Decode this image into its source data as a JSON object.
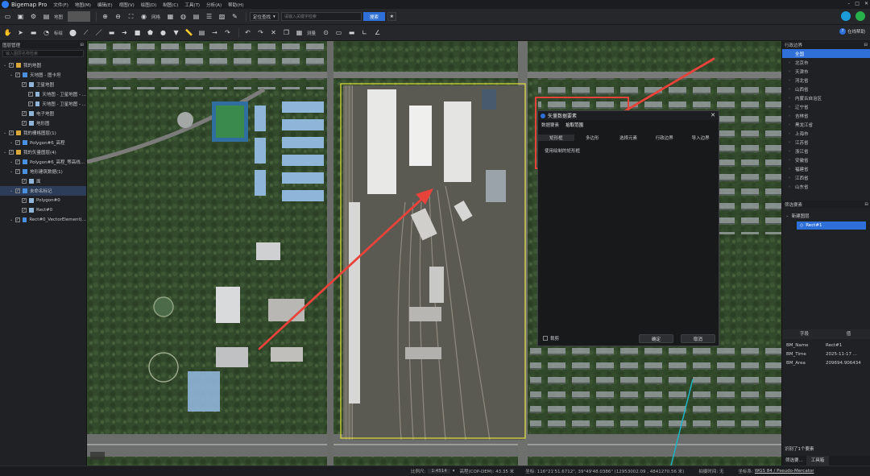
{
  "app": {
    "title": "Bigemap Pro"
  },
  "menu": [
    "文件(F)",
    "地图(M)",
    "编辑(E)",
    "视图(V)",
    "绘图(D)",
    "制图(C)",
    "工具(T)",
    "分析(A)",
    "帮助(H)"
  ],
  "toolbar1": {
    "map_label": "地图",
    "grid_label": "网格",
    "locate_dropdown": "定位查找",
    "search_placeholder": "请输入关键字检索",
    "search_button": "搜索"
  },
  "toolbar2": {
    "draw_label": "标绘",
    "measure_label": "测量",
    "online_help": "在线帮助"
  },
  "left_panel": {
    "title": "图层管理",
    "search_placeholder": "输入图层名称检索",
    "tree": [
      {
        "label": "我的地图",
        "level": 0
      },
      {
        "label": "天地图 - 图卡坦",
        "level": 1
      },
      {
        "label": "卫星地图",
        "level": 2
      },
      {
        "label": "天地图 - 卫星地图 - ...",
        "level": 3
      },
      {
        "label": "天地图 - 卫星地图 - ...",
        "level": 3
      },
      {
        "label": "电子地图",
        "level": 2
      },
      {
        "label": "地形图",
        "level": 2
      },
      {
        "label": "我的栅格图层(1)",
        "level": 0
      },
      {
        "label": "Polygon#6_高程",
        "level": 1
      },
      {
        "label": "我的矢量图层(4)",
        "level": 0
      },
      {
        "label": "Polygon#6_高程_等高线...",
        "level": 1
      },
      {
        "label": "地形建筑数据(1)",
        "level": 1
      },
      {
        "label": "面",
        "level": 2
      },
      {
        "label": "未命名标记",
        "level": 1
      },
      {
        "label": "Polygon#0",
        "level": 2
      },
      {
        "label": "Rect#0",
        "level": 2
      },
      {
        "label": "Rect#0_VectorElement(...",
        "level": 1
      }
    ]
  },
  "right_panel": {
    "title": "行政边界",
    "regions": [
      "全国",
      "北京市",
      "天津市",
      "河北省",
      "山西省",
      "内蒙古自治区",
      "辽宁省",
      "吉林省",
      "黑龙江省",
      "上海市",
      "江苏省",
      "浙江省",
      "安徽省",
      "福建省",
      "江西省",
      "山东省"
    ],
    "filter_title": "筛选要素",
    "filter_group": "新建图层",
    "filter_item": "Rect#1",
    "attr_headers": [
      "字段",
      "值"
    ],
    "attributes": [
      {
        "field": "BM_Name",
        "value": "Rect#1"
      },
      {
        "field": "BM_Time",
        "value": "2025-11-17 ..."
      },
      {
        "field": "BM_Area",
        "value": "209694.906434"
      }
    ],
    "result_text": "识别了1个要素",
    "tabs": [
      "筛选要...",
      "工具箱"
    ]
  },
  "dialog": {
    "title": "矢量数据要素",
    "tabs": [
      "数据要素",
      "拾取范围"
    ],
    "subtabs": [
      "矩形框",
      "多边形",
      "选择元素",
      "行政边界",
      "导入边界"
    ],
    "hint": "使用绘制的矩形框",
    "checkbox_label": "裁剪",
    "ok": "确定",
    "cancel": "取消"
  },
  "status": {
    "scale_label": "比例尺:",
    "scale_value": "1:4514",
    "elevation": "高程(COP-DEM): 43.35 米",
    "coords": "坐标: 116°21'51.6712\", 39°49'48.0386\"  (12953002.09 , 4841270.56 米)",
    "capture_time": "拍摄时间: 无",
    "crs_label": "坐标系:",
    "crs_value": "WGS 84 / Pseudo-Mercator"
  },
  "colors": {
    "accent": "#2e6fd8",
    "annotation": "#e8433b",
    "boundary": "#e3e03a"
  }
}
